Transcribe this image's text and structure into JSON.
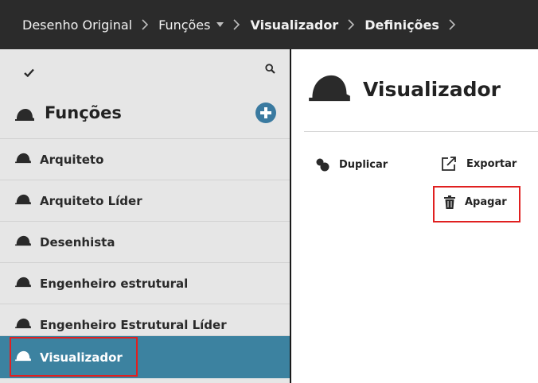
{
  "breadcrumb": {
    "items": [
      "Desenho Original",
      "Funções",
      "Visualizador",
      "Definições"
    ],
    "separator": "›",
    "dropdown_icon": "caret-down-icon"
  },
  "sidebar": {
    "toolbar": {
      "check_icon": "check-icon",
      "search_icon": "search-icon"
    },
    "section_title": "Funções",
    "add_icon": "plus-circle-icon",
    "items": [
      {
        "label": "Arquiteto"
      },
      {
        "label": "Arquiteto Líder"
      },
      {
        "label": "Desenhista"
      },
      {
        "label": "Engenheiro estrutural"
      },
      {
        "label": "Engenheiro Estrutural Líder"
      },
      {
        "label": "Visualizador",
        "selected": true
      }
    ]
  },
  "main": {
    "title": "Visualizador",
    "actions": {
      "duplicate": "Duplicar",
      "export": "Exportar",
      "delete": "Apagar"
    }
  },
  "colors": {
    "topbar": "#2b2b2b",
    "sidebar_bg": "#e6e6e6",
    "selected": "#3c82a0",
    "add_button": "#3a7aa0",
    "highlight": "#e02020"
  }
}
